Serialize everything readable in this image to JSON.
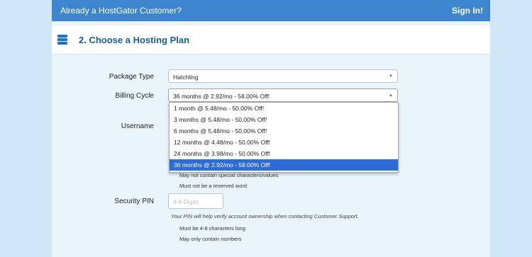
{
  "topbar": {
    "title": "Already a HostGator Customer?",
    "sign_in": "Sign In!"
  },
  "section": {
    "icon": "server-icon",
    "heading": "2. Choose a Hosting Plan"
  },
  "package": {
    "label": "Package Type",
    "value": "Hatchling"
  },
  "billing": {
    "label": "Billing Cycle",
    "value": "36 months @ 2.92/mo - 58.00% Off!",
    "options": [
      "1 month @ 5.48/mo - 50.00% Off!",
      "3 months @ 5.48/mo - 50.00% Off!",
      "6 months @ 5.48/mo - 50.00% Off!",
      "12 months @ 4.48/mo - 50.00% Off!",
      "24 months @ 3.98/mo - 50.00% Off!",
      "36 months @ 2.92/mo - 58.00% Off!"
    ],
    "selected_index": 5
  },
  "username": {
    "label": "Username",
    "rules": [
      "May not contain special characters/values",
      "Must not be a reserved word"
    ]
  },
  "pin": {
    "label": "Security PIN",
    "placeholder": "4-8 Digits",
    "help": "Your PIN will help verify account ownership when contacting Customer Support.",
    "rules": [
      "Must be 4-8 characters long",
      "May only contain numbers"
    ]
  },
  "colors": {
    "accent": "#3d86cf",
    "heading": "#185c93",
    "selected": "#2d6cd5"
  }
}
